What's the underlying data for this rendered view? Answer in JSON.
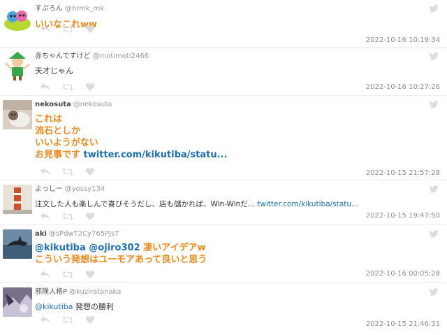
{
  "tweets": [
    {
      "name": "すぷろん",
      "handle": "@hrmk_mk",
      "lines": [
        "いいなこれww"
      ],
      "link": "",
      "time": "2022-10-16 10:19:34"
    },
    {
      "name": "赤ちゃんですけど",
      "handle": "@motimoti2466",
      "lines": [
        "天才じゃん"
      ],
      "link": "",
      "time": "2022-10-16 10:27:26"
    },
    {
      "name": "nekosuta",
      "handle": "@nekosuta",
      "lines": [
        "これは",
        "流石としか",
        "いいようがない",
        "お見事です"
      ],
      "link": "twitter.com/kikutiba/statu...",
      "time": "2022-10-15 21:57:28"
    },
    {
      "name": "よっしー",
      "handle": "@yossy134",
      "lines": [
        "注文した人も楽しんで喜びそうだし、店も儲かれば、Win-Winだ..."
      ],
      "link": "twitter.com/kikutiba/statu...",
      "time": "2022-10-15 19:47:50"
    },
    {
      "name": "aki",
      "handle": "@sPdwT2Cy765PJsT",
      "mentions": [
        "@kikutiba",
        "@ojiro302"
      ],
      "lines": [
        "凄いアイデアw",
        "こういう発想はユーモアあって良いと思う"
      ],
      "link": "",
      "time": "2022-10-16 00:05:28"
    },
    {
      "name": "邪険人格P",
      "handle": "@kuziratanaka",
      "mentions": [
        "@kikutiba"
      ],
      "lines": [
        "発想の勝利"
      ],
      "link": "",
      "time": "2022-10-15 21:46:31"
    }
  ],
  "colors": {
    "accent": "#ef8a1a",
    "link": "#1d6fb8",
    "icon": "#dcdcdc"
  }
}
